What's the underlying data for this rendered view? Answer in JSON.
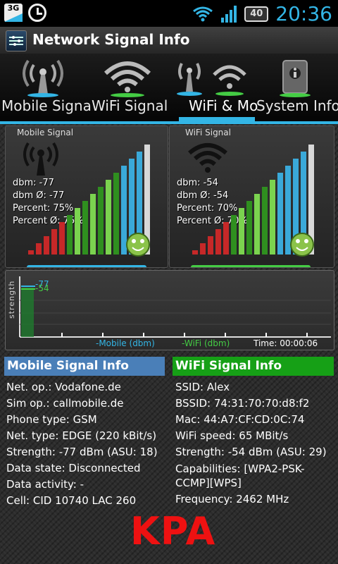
{
  "status_bar": {
    "network_badge": "3G",
    "battery_level": "40",
    "time": "20:36",
    "icons": [
      "3g-icon",
      "alarm-icon",
      "wifi-icon",
      "cell-signal-icon",
      "battery-icon"
    ]
  },
  "app": {
    "title": "Network Signal Info"
  },
  "tabs": [
    {
      "label": "Mobile Signa",
      "active": false
    },
    {
      "label": "WiFi Signal",
      "active": false
    },
    {
      "label": "WiFi & Mo",
      "active": true
    },
    {
      "label": "System Info",
      "active": false
    }
  ],
  "mobile_panel": {
    "title": "Mobile Signal",
    "dbm": "dbm: -77",
    "dbm_avg": "dbm Ø: -77",
    "percent": "Percent: 75%",
    "percent_avg": "Percent Ø: 75%",
    "level": 0.75,
    "accent": "#33b5e5"
  },
  "wifi_panel": {
    "title": "WiFi Signal",
    "dbm": "dbm: -54",
    "dbm_avg": "dbm Ø: -54",
    "percent": "Percent: 70%",
    "percent_avg": "Percent Ø: 70%",
    "level": 0.7,
    "accent": "#44cc44"
  },
  "graph": {
    "y_label": "strength",
    "mobile_value_label": "-77",
    "wifi_value_label": "-54",
    "legend_mobile": "-Mobile (dbm)",
    "legend_wifi": "-WiFi (dbm)",
    "time_label": "Time: 00:00:06"
  },
  "mobile_info": {
    "heading": "Mobile Signal Info",
    "rows": [
      "Net. op.: Vodafone.de",
      "Sim op.: callmobile.de",
      "Phone type: GSM",
      "Net. type: EDGE (220 kBit/s)",
      "Strength: -77 dBm (ASU: 18)",
      "Data state: Disconnected",
      "Data activity: -",
      "Cell: CID 10740 LAC 260"
    ]
  },
  "wifi_info": {
    "heading": "WiFi Signal Info",
    "rows": [
      "SSID: Alex",
      "BSSID: 74:31:70:70:d8:f2",
      "Mac: 44:A7:CF:CD:0C:74",
      "WiFi speed: 65 MBit/s",
      "Strength: -54 dBm (ASU: 29)",
      "Capabilities: [WPA2-PSK-CCMP][WPS]",
      "Frequency: 2462 MHz"
    ]
  },
  "watermark": "KPA",
  "colors": {
    "accent_blue": "#33b5e5",
    "mobile_header": "#4a7fb8",
    "wifi_header": "#16a016",
    "watermark": "#ee1111"
  }
}
